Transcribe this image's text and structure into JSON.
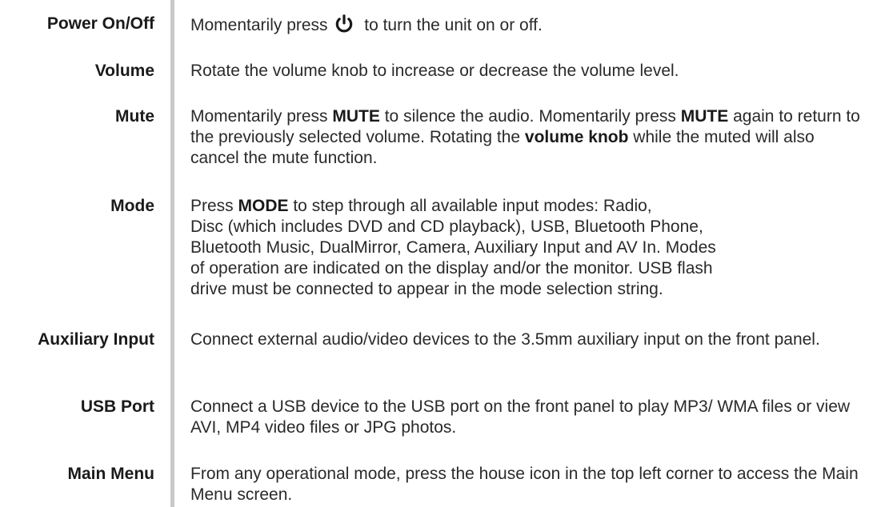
{
  "rows": [
    {
      "term": "Power On/Off",
      "pre": "Momentarily press",
      "icon": "power-icon",
      "post": "to turn the unit on or off."
    },
    {
      "term": "Volume",
      "text": "Rotate the volume knob to increase or decrease the volume level."
    },
    {
      "term": "Mute",
      "t1": "Momentarily press ",
      "b1": "MUTE",
      "t2": " to silence the audio. Momentarily press ",
      "b2": "MUTE",
      "t3": " again to return to the previously selected volume. Rotating the ",
      "b3": "volume knob",
      "t4": " while the muted will also cancel the mute function."
    },
    {
      "term": "Mode",
      "t1": "Press ",
      "b1": "MODE",
      "t2": " to step through all available input modes: Radio,",
      "line2": "Disc (which includes DVD and CD playback), USB, Bluetooth Phone,",
      "line3": "Bluetooth Music, DualMirror, Camera, Auxiliary Input and AV In. Modes",
      "line4": "of operation are indicated on the display and/or the monitor. USB flash",
      "line5": "drive must be connected to appear in the mode selection string."
    },
    {
      "term": "Auxiliary Input",
      "text": "Connect external audio/video devices to the 3.5mm auxiliary input on the front panel."
    },
    {
      "term": "USB Port",
      "text": "Connect a USB device to the USB port on the front panel to play MP3/ WMA files or view AVI, MP4 video files or JPG photos."
    },
    {
      "term": "Main Menu",
      "text": "From any operational mode, press the house icon in the top left corner to access the Main Menu screen."
    }
  ]
}
